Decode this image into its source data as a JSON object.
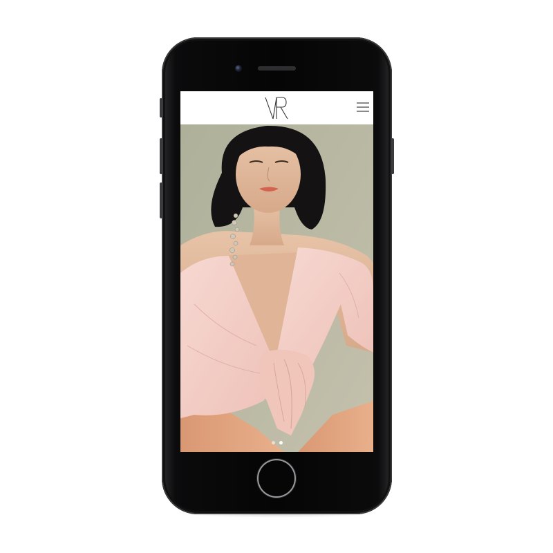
{
  "site": {
    "logo_text": "VR",
    "menu_icon": "hamburger-menu-icon"
  },
  "carousel": {
    "slide_count": 2,
    "active_index": 1,
    "image_subject": "model-portrait"
  },
  "colors": {
    "header_bg": "#ffffff",
    "photo_background": "#b9b7a2",
    "blouse": "#f3cfc8",
    "trousers": "#e0a27c",
    "phone_body": "#0b0b0c"
  }
}
